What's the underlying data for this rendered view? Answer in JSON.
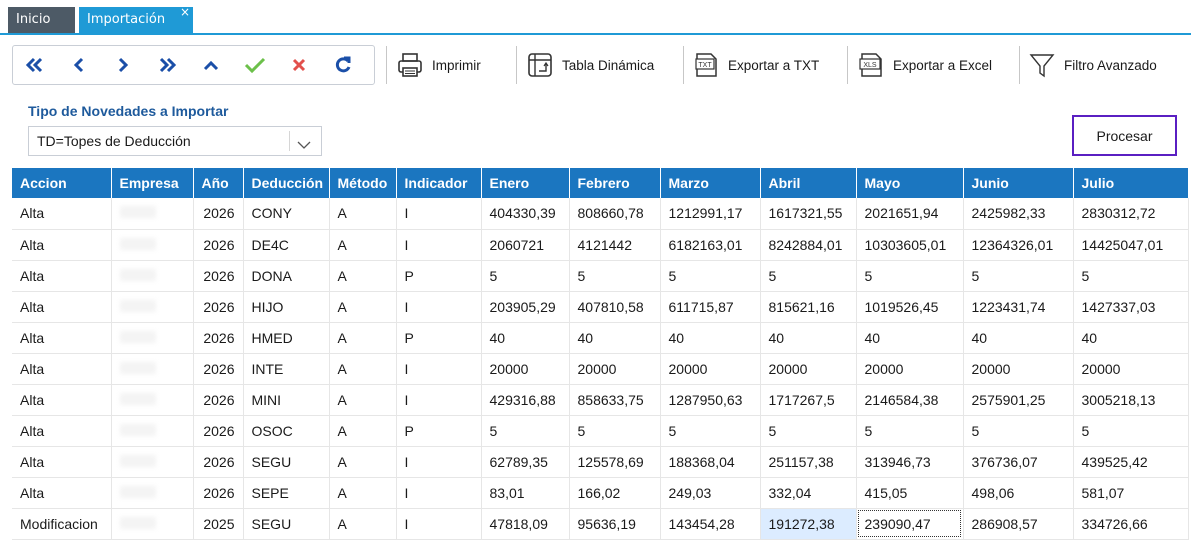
{
  "tabs": [
    {
      "label": "Inicio",
      "close": ""
    },
    {
      "label": "Importación",
      "close": "×"
    }
  ],
  "toolbar": {
    "nav_icons": [
      "first-page-icon",
      "previous-icon",
      "next-icon",
      "last-page-icon",
      "collapse-icon",
      "accept-icon",
      "cancel-icon",
      "refresh-icon"
    ],
    "print_label": "Imprimir",
    "pivot_label": "Tabla Dinámica",
    "export_txt_label": "Exportar a TXT",
    "export_txt_icon_text": "TXT",
    "export_excel_label": "Exportar a Excel",
    "export_excel_icon_text": "XLS",
    "filter_label": "Filtro Avanzado"
  },
  "form": {
    "tipo_label": "Tipo de Novedades a Importar",
    "tipo_value": "TD=Topes de Deducción",
    "process_label": "Procesar"
  },
  "colors": {
    "accent": "#1b76c0",
    "tab_active": "#1f9ad6",
    "tab_inactive": "#4d5a66",
    "focus_border": "#5a1fc2",
    "check": "#6cc04a",
    "cancel": "#e2504c"
  },
  "table": {
    "headers": [
      "Accion",
      "Empresa",
      "Año",
      "Deducción",
      "Método",
      "Indicador",
      "Enero",
      "Febrero",
      "Marzo",
      "Abril",
      "Mayo",
      "Junio",
      "Julio"
    ],
    "rows": [
      [
        "Alta",
        "",
        "2026",
        "CONY",
        "A",
        "I",
        "404330,39",
        "808660,78",
        "1212991,17",
        "1617321,55",
        "2021651,94",
        "2425982,33",
        "2830312,72"
      ],
      [
        "Alta",
        "",
        "2026",
        "DE4C",
        "A",
        "I",
        "2060721",
        "4121442",
        "6182163,01",
        "8242884,01",
        "10303605,01",
        "12364326,01",
        "14425047,01"
      ],
      [
        "Alta",
        "",
        "2026",
        "DONA",
        "A",
        "P",
        "5",
        "5",
        "5",
        "5",
        "5",
        "5",
        "5"
      ],
      [
        "Alta",
        "",
        "2026",
        "HIJO",
        "A",
        "I",
        "203905,29",
        "407810,58",
        "611715,87",
        "815621,16",
        "1019526,45",
        "1223431,74",
        "1427337,03"
      ],
      [
        "Alta",
        "",
        "2026",
        "HMED",
        "A",
        "P",
        "40",
        "40",
        "40",
        "40",
        "40",
        "40",
        "40"
      ],
      [
        "Alta",
        "",
        "2026",
        "INTE",
        "A",
        "I",
        "20000",
        "20000",
        "20000",
        "20000",
        "20000",
        "20000",
        "20000"
      ],
      [
        "Alta",
        "",
        "2026",
        "MINI",
        "A",
        "I",
        "429316,88",
        "858633,75",
        "1287950,63",
        "1717267,5",
        "2146584,38",
        "2575901,25",
        "3005218,13"
      ],
      [
        "Alta",
        "",
        "2026",
        "OSOC",
        "A",
        "P",
        "5",
        "5",
        "5",
        "5",
        "5",
        "5",
        "5"
      ],
      [
        "Alta",
        "",
        "2026",
        "SEGU",
        "A",
        "I",
        "62789,35",
        "125578,69",
        "188368,04",
        "251157,38",
        "313946,73",
        "376736,07",
        "439525,42"
      ],
      [
        "Alta",
        "",
        "2026",
        "SEPE",
        "A",
        "I",
        "83,01",
        "166,02",
        "249,03",
        "332,04",
        "415,05",
        "498,06",
        "581,07"
      ],
      [
        "Modificacion",
        "",
        "2025",
        "SEGU",
        "A",
        "I",
        "47818,09",
        "95636,19",
        "143454,28",
        "191272,38",
        "239090,47",
        "286908,57",
        "334726,66"
      ]
    ]
  }
}
